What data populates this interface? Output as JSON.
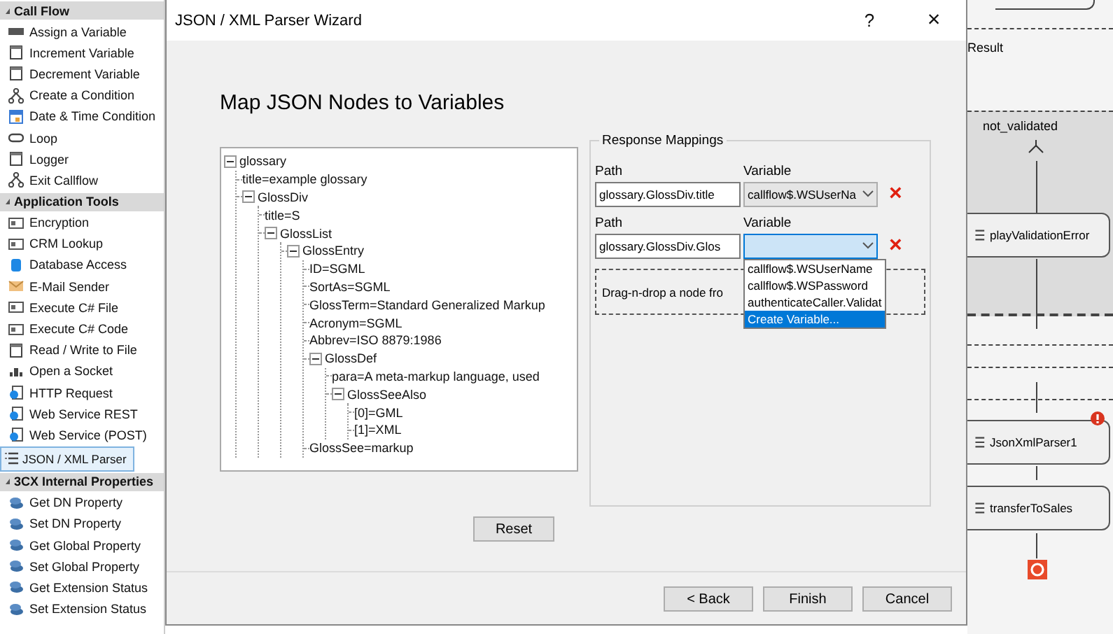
{
  "sidebar": {
    "groups": [
      {
        "title": "Call Flow",
        "expanded": true,
        "items": [
          {
            "label": "Assign a Variable",
            "selected": false
          },
          {
            "label": "Increment Variable",
            "selected": false
          },
          {
            "label": "Decrement Variable",
            "selected": false
          },
          {
            "label": "Create a Condition",
            "selected": false
          },
          {
            "label": "Date & Time Condition",
            "selected": false
          },
          {
            "label": "Loop",
            "selected": false
          },
          {
            "label": "Logger",
            "selected": false
          },
          {
            "label": "Exit Callflow",
            "selected": false
          }
        ]
      },
      {
        "title": "Application Tools",
        "expanded": true,
        "items": [
          {
            "label": "Encryption",
            "selected": false
          },
          {
            "label": "CRM Lookup",
            "selected": false
          },
          {
            "label": "Database Access",
            "selected": false
          },
          {
            "label": "E-Mail Sender",
            "selected": false
          },
          {
            "label": "Execute C# File",
            "selected": false
          },
          {
            "label": "Execute C# Code",
            "selected": false
          },
          {
            "label": "Read / Write to File",
            "selected": false
          },
          {
            "label": "Open a Socket",
            "selected": false
          },
          {
            "label": "HTTP Request",
            "selected": false
          },
          {
            "label": "Web Service REST",
            "selected": false
          },
          {
            "label": "Web Service (POST)",
            "selected": false
          },
          {
            "label": "JSON / XML Parser",
            "selected": true
          }
        ]
      },
      {
        "title": "3CX Internal Properties",
        "expanded": true,
        "items": [
          {
            "label": "Get DN Property",
            "selected": false
          },
          {
            "label": "Set DN Property",
            "selected": false
          },
          {
            "label": "Get Global Property",
            "selected": false
          },
          {
            "label": "Set Global Property",
            "selected": false
          },
          {
            "label": "Get Extension Status",
            "selected": false
          },
          {
            "label": "Set Extension Status",
            "selected": false
          }
        ]
      }
    ]
  },
  "dialog": {
    "title": "JSON / XML Parser Wizard",
    "help": "?",
    "close": "×",
    "heading": "Map JSON Nodes to Variables",
    "tree": [
      {
        "label": "glossary",
        "expanded": true,
        "children": [
          {
            "label": "title=example glossary"
          },
          {
            "label": "GlossDiv",
            "expanded": true,
            "children": [
              {
                "label": "title=S"
              },
              {
                "label": "GlossList",
                "expanded": true,
                "children": [
                  {
                    "label": "GlossEntry",
                    "expanded": true,
                    "children": [
                      {
                        "label": "ID=SGML"
                      },
                      {
                        "label": "SortAs=SGML"
                      },
                      {
                        "label": "GlossTerm=Standard Generalized Markup"
                      },
                      {
                        "label": "Acronym=SGML"
                      },
                      {
                        "label": "Abbrev=ISO 8879:1986"
                      },
                      {
                        "label": "GlossDef",
                        "expanded": true,
                        "children": [
                          {
                            "label": "para=A meta-markup language, used"
                          },
                          {
                            "label": "GlossSeeAlso",
                            "expanded": true,
                            "children": [
                              {
                                "label": "[0]=GML"
                              },
                              {
                                "label": "[1]=XML"
                              }
                            ]
                          }
                        ]
                      },
                      {
                        "label": "GlossSee=markup"
                      }
                    ]
                  }
                ]
              }
            ]
          }
        ]
      }
    ],
    "reset": "Reset",
    "mappings": {
      "title": "Response Mappings",
      "rows": [
        {
          "path_label": "Path",
          "variable_label": "Variable",
          "path": "glossary.GlossDiv.title",
          "variable": "callflow$.WSUserNa",
          "focused": false,
          "remove": "×"
        },
        {
          "path_label": "Path",
          "variable_label": "Variable",
          "focused": true,
          "path": "glossary.GlossDiv.Glos",
          "remove": "×",
          "dropdown": [
            {
              "label": "callflow$.WSUserName",
              "selected": false
            },
            {
              "label": "callflow$.WSPassword",
              "selected": false
            },
            {
              "label": "authenticateCaller.Validat",
              "selected": false
            },
            {
              "label": "Create Variable...",
              "selected": true
            }
          ]
        }
      ],
      "drop_hint": "Drag-n-drop a node fro"
    },
    "buttons": [
      {
        "label": "< Back",
        "default": false
      },
      {
        "label": "Finish",
        "default": false
      },
      {
        "label": "Cancel",
        "default": false
      }
    ]
  },
  "canvas": {
    "result_label": "Result",
    "branch_label": "not_validated",
    "nodes": [
      {
        "label": "playValidationError",
        "error": false
      },
      {
        "label": "JsonXmlParser1",
        "error": true
      },
      {
        "label": "transferToSales",
        "error": false
      }
    ]
  }
}
